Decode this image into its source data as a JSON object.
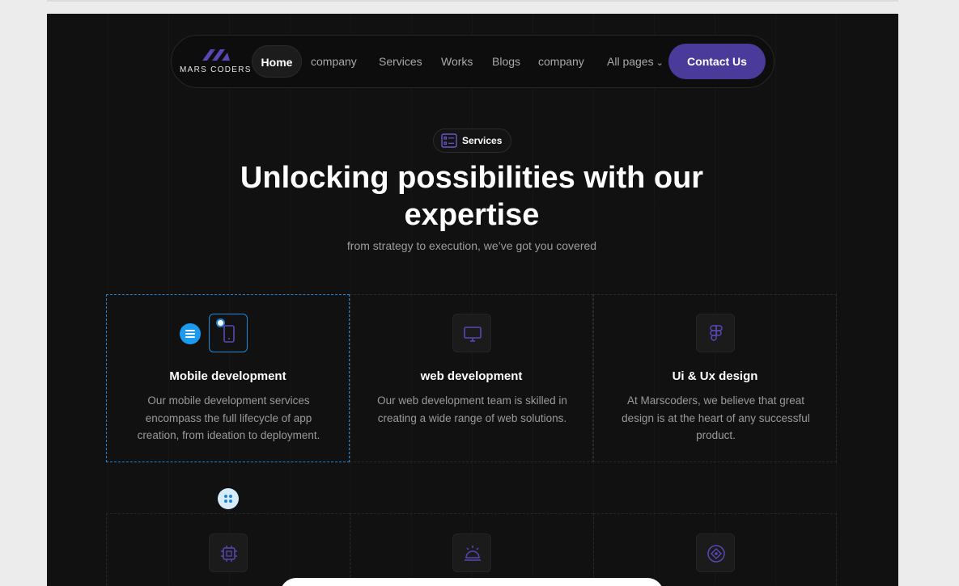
{
  "brand": {
    "logo_text": "MARS CODERS",
    "accent": "#4a3b9a",
    "icon_color": "#5a46b4"
  },
  "nav": {
    "links": [
      "Home",
      "company",
      "Services",
      "Works",
      "Blogs",
      "company",
      "All pages"
    ],
    "cta": "Contact Us"
  },
  "hero": {
    "badge": "Services",
    "title_line1": "Unlocking possibilities with our",
    "title_line2": "expertise",
    "subtitle": "from strategy to execution, we’ve got you covered"
  },
  "services": [
    {
      "title": "Mobile development",
      "description": "Our mobile development services encompass the full lifecycle of app creation, from ideation to deployment.",
      "icon": "smartphone-icon"
    },
    {
      "title": "web development",
      "description": "Our web development team is skilled in creating a wide range of web solutions.",
      "icon": "monitor-icon"
    },
    {
      "title": "Ui & Ux design",
      "description": "At Marscoders, we believe that great design is at the heart of any successful product.",
      "icon": "figma-icon"
    }
  ],
  "services_row2_icons": [
    "chip-icon",
    "sunrise-icon",
    "ai-badge-icon"
  ]
}
